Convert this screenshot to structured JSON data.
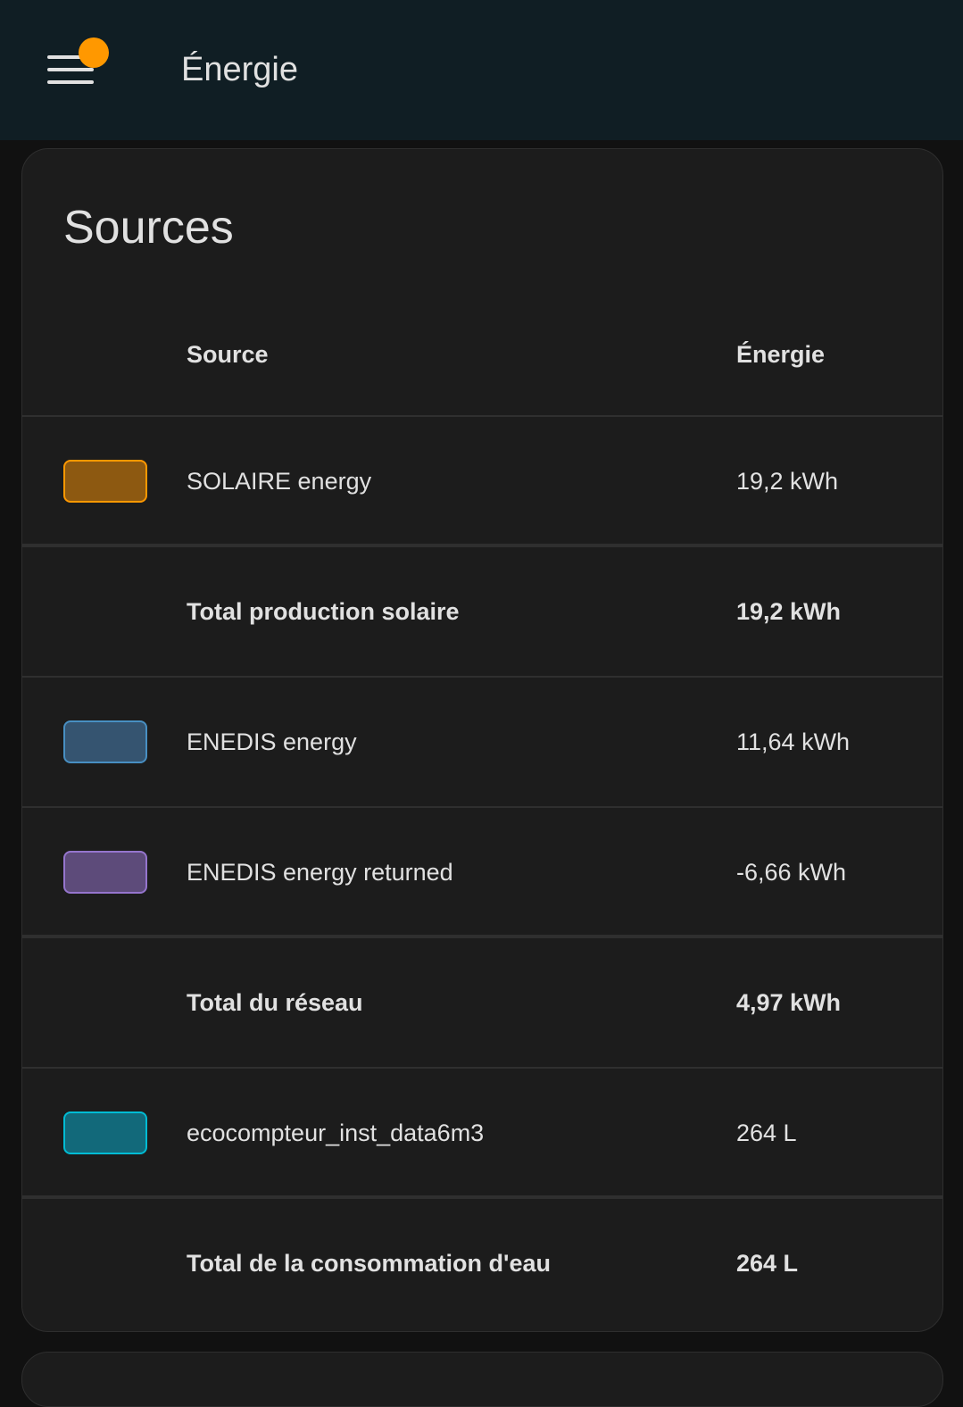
{
  "header": {
    "title": "Énergie",
    "menu_icon": "menu-icon",
    "notification_color": "#ff9800"
  },
  "card": {
    "title": "Sources",
    "columns": {
      "source": "Source",
      "energy": "Énergie"
    },
    "rows": [
      {
        "type": "item",
        "name": "SOLAIRE energy",
        "value": "19,2 kWh",
        "color_fill": "#8d5911",
        "color_border": "#ff9800"
      },
      {
        "type": "total",
        "name": "Total production solaire",
        "value": "19,2 kWh"
      },
      {
        "type": "item",
        "name": "ENEDIS energy",
        "value": "11,64 kWh",
        "color_fill": "#355470",
        "color_border": "#488fc2"
      },
      {
        "type": "item",
        "name": "ENEDIS energy returned",
        "value": "-6,66 kWh",
        "color_fill": "#5d4b7a",
        "color_border": "#9575cd"
      },
      {
        "type": "total",
        "name": "Total du réseau",
        "value": "4,97 kWh"
      },
      {
        "type": "item",
        "name": "ecocompteur_inst_data6m3",
        "value": "264 L",
        "color_fill": "#12697a",
        "color_border": "#00bcd4"
      },
      {
        "type": "total",
        "name": "Total de la consommation d'eau",
        "value": "264 L"
      }
    ]
  }
}
